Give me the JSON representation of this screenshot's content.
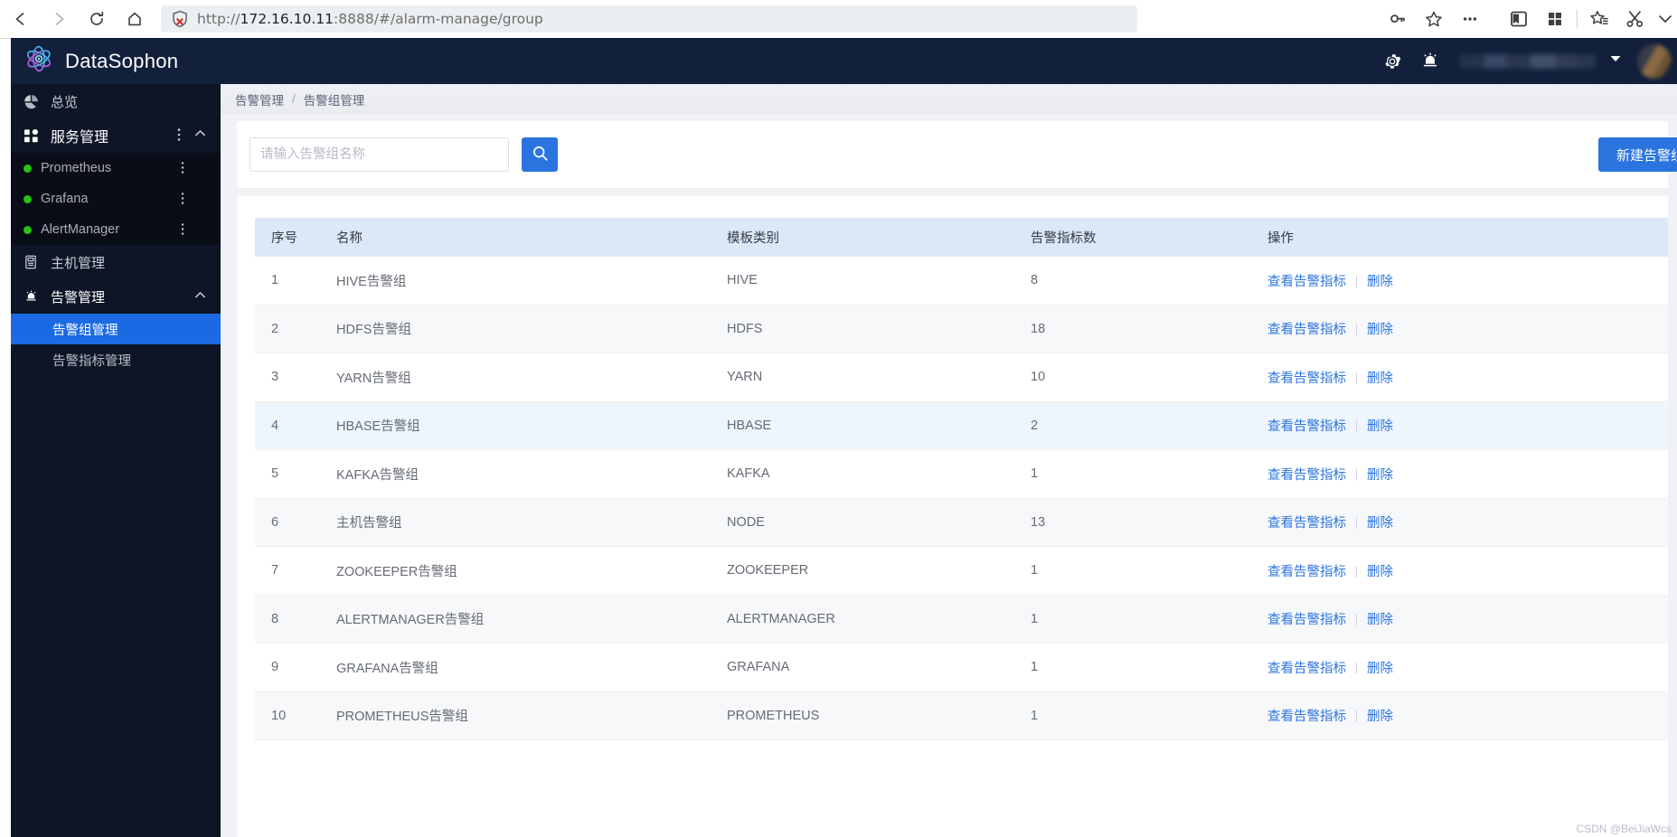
{
  "browser": {
    "back_label": "Back",
    "forward_label": "Forward",
    "reload_label": "Reload",
    "home_label": "Home",
    "url_scheme": "http://",
    "url_host": "172.16.10.11",
    "url_rest": ":8888/#/alarm-manage/group",
    "url_full": "http://172.16.10.11:8888/#/alarm-manage/group",
    "toolbar_icons": [
      "key-icon",
      "star-icon",
      "more-icon",
      "reading-view-icon",
      "collections-icon",
      "favorites-bar-icon",
      "clip-icon"
    ]
  },
  "header": {
    "brand": "DataSophon",
    "logo_icon": "atom-logo-icon",
    "settings_icon": "gear-icon",
    "alarm_icon": "siren-icon",
    "user_name": "",
    "caret_icon": "chevron-down-icon",
    "avatar_icon": "avatar"
  },
  "sidebar": {
    "items": [
      {
        "label": "总览",
        "icon": "pie-chart-icon",
        "active": false
      },
      {
        "label": "服务管理",
        "icon": "grid-apps-icon",
        "active": false,
        "expanded": true
      },
      {
        "label": "主机管理",
        "icon": "server-icon",
        "active": false
      },
      {
        "label": "告警管理",
        "icon": "siren-icon",
        "active": false,
        "expanded": true
      }
    ],
    "services": [
      {
        "label": "Prometheus",
        "status_color": "#25c415"
      },
      {
        "label": "Grafana",
        "status_color": "#25c415"
      },
      {
        "label": "AlertManager",
        "status_color": "#25c415"
      }
    ],
    "alarm_children": [
      {
        "label": "告警组管理",
        "active": true
      },
      {
        "label": "告警指标管理",
        "active": false
      }
    ]
  },
  "breadcrumb": {
    "parent": "告警管理",
    "separator": "/",
    "current": "告警组管理"
  },
  "toolbar": {
    "search_placeholder": "请输入告警组名称",
    "search_value": "",
    "search_icon": "search-icon",
    "new_group_label": "新建告警组"
  },
  "table": {
    "columns": [
      "序号",
      "名称",
      "模板类别",
      "告警指标数",
      "操作"
    ],
    "actions": {
      "view": "查看告警指标",
      "delete": "删除"
    },
    "rows": [
      {
        "idx": "1",
        "name": "HIVE告警组",
        "template": "HIVE",
        "count": "8"
      },
      {
        "idx": "2",
        "name": "HDFS告警组",
        "template": "HDFS",
        "count": "18"
      },
      {
        "idx": "3",
        "name": "YARN告警组",
        "template": "YARN",
        "count": "10"
      },
      {
        "idx": "4",
        "name": "HBASE告警组",
        "template": "HBASE",
        "count": "2"
      },
      {
        "idx": "5",
        "name": "KAFKA告警组",
        "template": "KAFKA",
        "count": "1"
      },
      {
        "idx": "6",
        "name": "主机告警组",
        "template": "NODE",
        "count": "13"
      },
      {
        "idx": "7",
        "name": "ZOOKEEPER告警组",
        "template": "ZOOKEEPER",
        "count": "1"
      },
      {
        "idx": "8",
        "name": "ALERTMANAGER告警组",
        "template": "ALERTMANAGER",
        "count": "1"
      },
      {
        "idx": "9",
        "name": "GRAFANA告警组",
        "template": "GRAFANA",
        "count": "1"
      },
      {
        "idx": "10",
        "name": "PROMETHEUS告警组",
        "template": "PROMETHEUS",
        "count": "1"
      }
    ]
  },
  "watermark": "CSDN @BeiJiaWcs",
  "colors": {
    "accent": "#2b74e0",
    "header_bg": "#12203c",
    "sidebar_bg": "#0d1526",
    "table_header_bg": "#dce8f7",
    "status_ok": "#25c415"
  }
}
